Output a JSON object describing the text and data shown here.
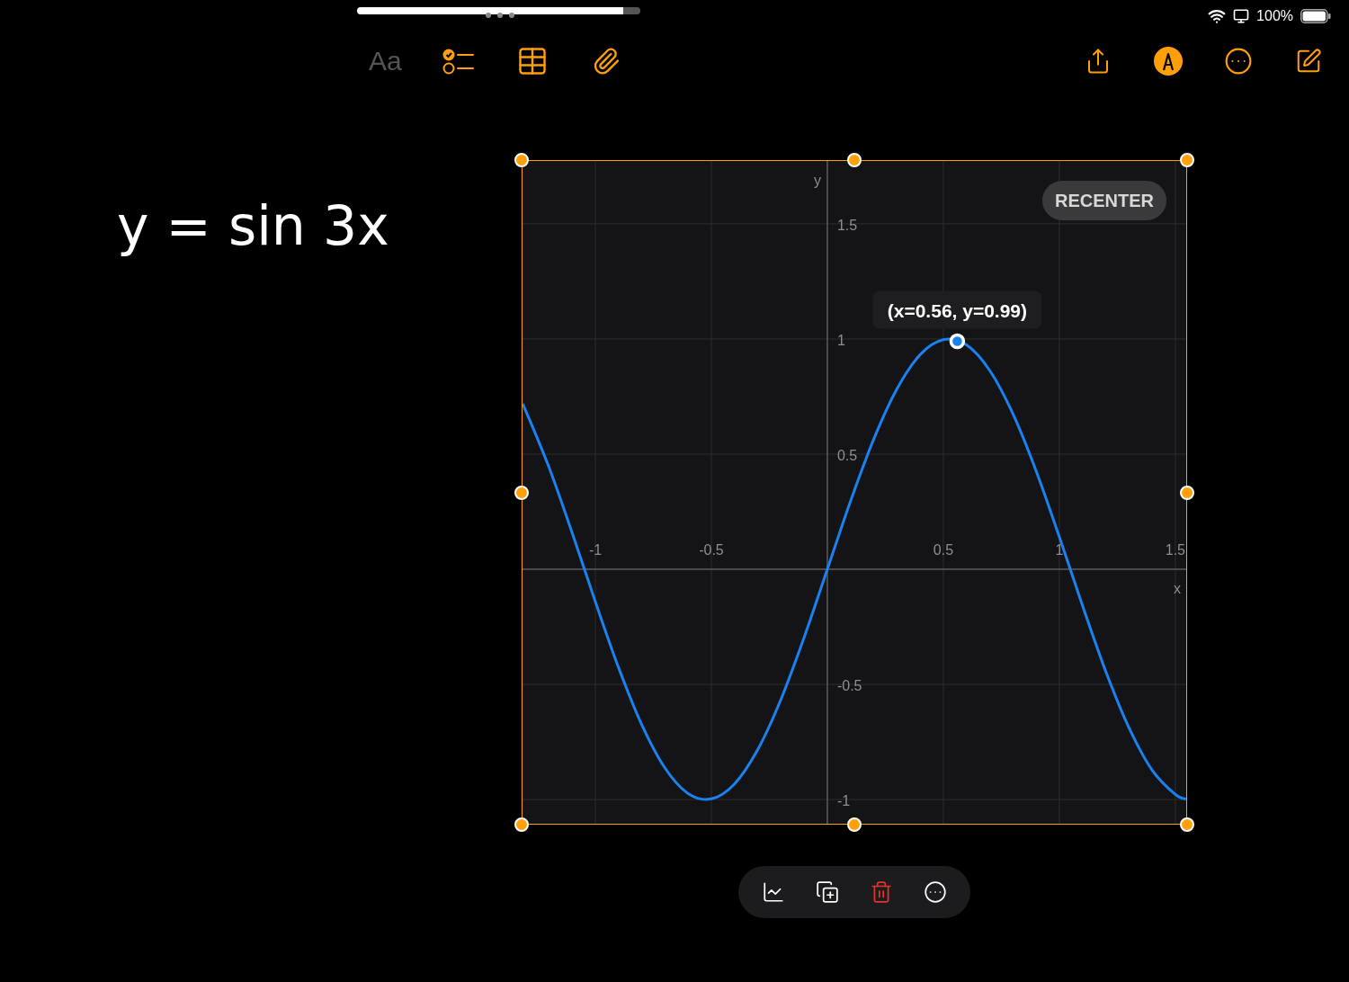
{
  "status_bar": {
    "battery": "100%"
  },
  "toolbar": {
    "left": [
      {
        "kind": "text",
        "label": "Aa",
        "disabled": true
      },
      {
        "kind": "checklist",
        "disabled": false
      },
      {
        "kind": "table",
        "disabled": false
      },
      {
        "kind": "attach",
        "disabled": false
      }
    ],
    "right": [
      {
        "kind": "share"
      },
      {
        "kind": "markup"
      },
      {
        "kind": "more"
      },
      {
        "kind": "compose"
      }
    ]
  },
  "note": {
    "handwriting": "y = sin 3x",
    "graph": {
      "selected": true,
      "recenter": "RECENTER",
      "chart_data": {
        "type": "line",
        "xlabel": "x",
        "ylabel": "y",
        "x": [
          -1.314,
          -1.3,
          -1.2,
          -1.1,
          -1.0,
          -0.9,
          -0.8,
          -0.7,
          -0.6,
          -0.5,
          -0.4,
          -0.3,
          -0.2,
          -0.1,
          0,
          0.1,
          0.2,
          0.3,
          0.4,
          0.5,
          0.6,
          0.7,
          0.8,
          0.9,
          1.0,
          1.1,
          1.2,
          1.3,
          1.4,
          1.5,
          1.547
        ],
        "grid": true,
        "series": [
          {
            "color": "#1a82f0",
            "values": [
              0.718,
              0.688,
              0.443,
              0.158,
              -0.141,
              -0.427,
              -0.675,
              -0.863,
              -0.974,
              -0.997,
              -0.932,
              -0.783,
              -0.565,
              -0.296,
              0,
              0.296,
              0.565,
              0.783,
              0.932,
              0.997,
              0.974,
              0.863,
              0.675,
              0.427,
              0.141,
              -0.158,
              -0.443,
              -0.688,
              -0.872,
              -0.978,
              -0.998
            ]
          }
        ],
        "xlim": [
          -1.314,
          1.547
        ],
        "ylim": [
          -1.105,
          1.773
        ],
        "xticks": [
          -1,
          -0.5,
          0.5,
          1,
          1.5
        ],
        "yticks": [
          -1,
          -0.5,
          0.5,
          1,
          1.5
        ],
        "annotations": [
          {
            "x": 0.56,
            "y": 0.99,
            "text": "(x=0.56, y=0.99)"
          }
        ]
      }
    }
  },
  "graph_toolbar": [
    {
      "kind": "graph"
    },
    {
      "kind": "duplicate"
    },
    {
      "kind": "delete"
    },
    {
      "kind": "more"
    }
  ]
}
